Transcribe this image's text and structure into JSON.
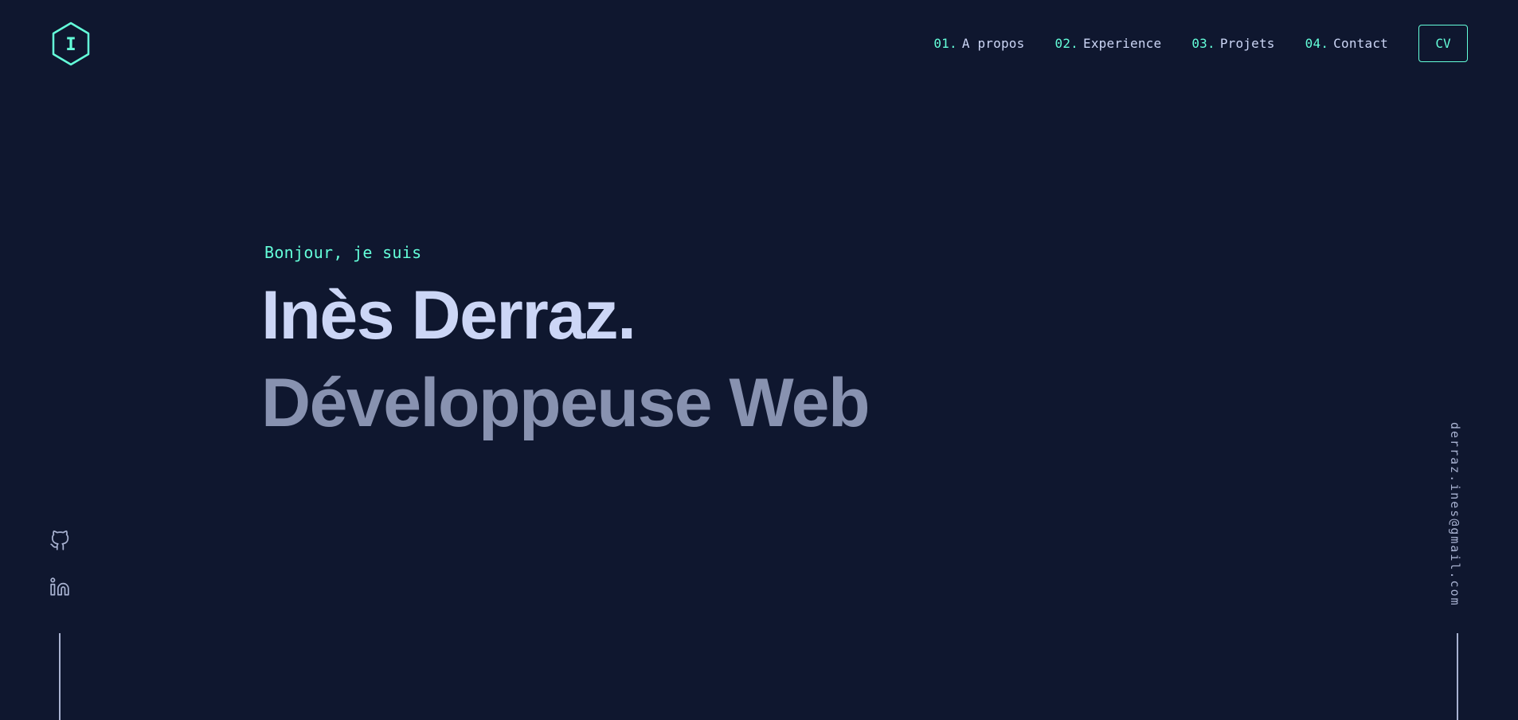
{
  "logo": {
    "letter": "I",
    "icon": "hexagon-logo-icon"
  },
  "nav": {
    "items": [
      {
        "num": "01.",
        "label": "A propos"
      },
      {
        "num": "02.",
        "label": "Experience"
      },
      {
        "num": "03.",
        "label": "Projets"
      },
      {
        "num": "04.",
        "label": "Contact"
      }
    ],
    "cv_label": "CV"
  },
  "hero": {
    "greeting": "Bonjour, je suis",
    "name": "Inès Derraz.",
    "role": "Développeuse Web"
  },
  "social": {
    "icons": [
      "github-icon",
      "linkedin-icon"
    ]
  },
  "email": "derraz.ines@gmail.com",
  "colors": {
    "background": "#0f172f",
    "accent": "#64ffda",
    "heading": "#ccd6f6",
    "subheading": "#8892b0",
    "muted": "#a8b2d1"
  }
}
